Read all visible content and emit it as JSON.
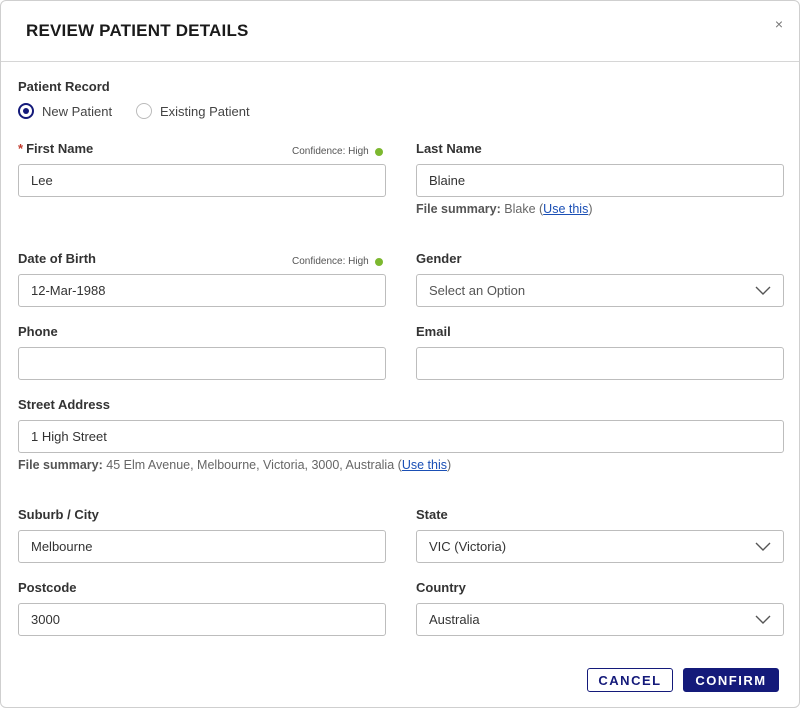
{
  "dialog": {
    "title": "REVIEW PATIENT DETAILS",
    "close_label": "×"
  },
  "patient_record": {
    "label": "Patient Record",
    "options": [
      {
        "label": "New Patient",
        "selected": true
      },
      {
        "label": "Existing Patient",
        "selected": false
      }
    ]
  },
  "fields": {
    "first_name": {
      "required_mark": "*",
      "label": "First Name",
      "value": "Lee",
      "confidence": "Confidence: High"
    },
    "last_name": {
      "label": "Last Name",
      "value": "Blaine",
      "summary_label": "File summary:",
      "summary_value": "Blake",
      "summary_link": "Use this"
    },
    "dob": {
      "label": "Date of Birth",
      "value": "12-Mar-1988",
      "confidence": "Confidence: High"
    },
    "gender": {
      "label": "Gender",
      "value": "Select an Option"
    },
    "phone": {
      "label": "Phone",
      "value": ""
    },
    "email": {
      "label": "Email",
      "value": ""
    },
    "street": {
      "label": "Street Address",
      "value": "1 High Street",
      "summary_label": "File summary:",
      "summary_value": "45 Elm Avenue, Melbourne, Victoria, 3000, Australia",
      "summary_link": "Use this"
    },
    "suburb": {
      "label": "Suburb / City",
      "value": "Melbourne"
    },
    "state": {
      "label": "State",
      "value": "VIC (Victoria)"
    },
    "postcode": {
      "label": "Postcode",
      "value": "3000"
    },
    "country": {
      "label": "Country",
      "value": "Australia"
    }
  },
  "actions": {
    "cancel_label": "CANCEL",
    "confirm_label": "CONFIRM"
  },
  "colors": {
    "primary": "#141a7a",
    "confidence_high": "#7cb82f",
    "link": "#1a4fb5",
    "required": "#c0392b"
  },
  "icons": {
    "close": "close-icon",
    "dropdown": "chevron-down-icon",
    "confidence": "status-dot-icon"
  }
}
